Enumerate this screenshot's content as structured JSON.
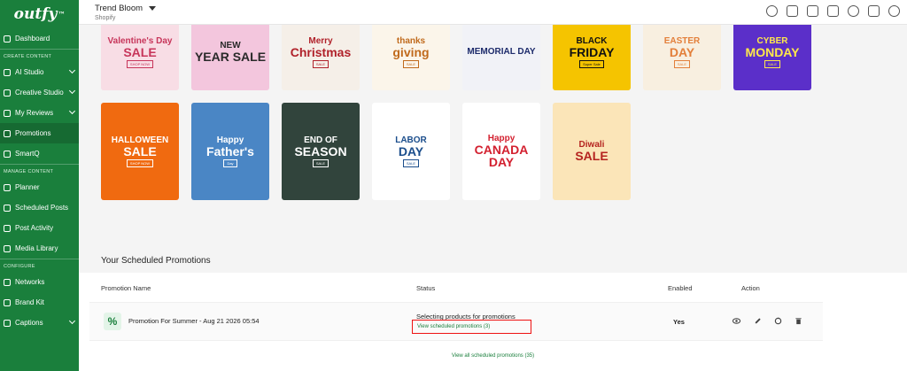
{
  "sidebar": {
    "logo": "outfy",
    "logo_mark": "™",
    "dashboard": "Dashboard",
    "sections": {
      "create": "CREATE CONTENT",
      "manage": "MANAGE CONTENT",
      "configure": "CONFIGURE"
    },
    "create_items": [
      "AI Studio",
      "Creative Studio",
      "My Reviews",
      "Promotions",
      "SmartQ"
    ],
    "manage_items": [
      "Planner",
      "Scheduled Posts",
      "Post Activity",
      "Media Library"
    ],
    "configure_items": [
      "Networks",
      "Brand Kit",
      "Captions"
    ]
  },
  "topbar": {
    "store_name": "Trend Bloom",
    "store_platform": "Shopify"
  },
  "templates": [
    {
      "line1": "Valentine's Day",
      "line2": "SALE",
      "line3": "SHOP NOW",
      "bg": "#f8dde5",
      "fg": "#c7355a"
    },
    {
      "line1": "NEW",
      "line2": "YEAR SALE",
      "line3": "",
      "bg": "#f3c6dd",
      "fg": "#2a2a2a"
    },
    {
      "line1": "Merry",
      "line2": "Christmas",
      "line3": "SALE",
      "bg": "#f5efe8",
      "fg": "#b0212a"
    },
    {
      "line1": "thanks",
      "line2": "giving",
      "line3": "SALE",
      "bg": "#fbf5ea",
      "fg": "#c06a1c"
    },
    {
      "line1": "MEMORIAL DAY",
      "line2": "",
      "line3": "",
      "bg": "#f1f2f7",
      "fg": "#1d2b6b"
    },
    {
      "line1": "BLACK",
      "line2": "FRIDAY",
      "line3": "Super Sale",
      "bg": "#f5c400",
      "fg": "#111111"
    },
    {
      "line1": "EASTER",
      "line2": "DAY",
      "line3": "SALE",
      "bg": "#f8efe0",
      "fg": "#e37f3a"
    },
    {
      "line1": "CYBER",
      "line2": "MONDAY",
      "line3": "SALE",
      "bg": "#5b2fc9",
      "fg": "#ffe94a"
    },
    {
      "line1": "HALLOWEEN",
      "line2": "SALE",
      "line3": "SHOP NOW",
      "bg": "#f06a10",
      "fg": "#ffffff"
    },
    {
      "line1": "Happy",
      "line2": "Father's",
      "line3": "Day",
      "bg": "#4a86c5",
      "fg": "#ffffff"
    },
    {
      "line1": "END OF",
      "line2": "SEASON",
      "line3": "SALE",
      "bg": "#31443c",
      "fg": "#ffffff"
    },
    {
      "line1": "LABOR",
      "line2": "DAY",
      "line3": "SALE",
      "bg": "#ffffff",
      "fg": "#1b4e8c"
    },
    {
      "line1": "Happy",
      "line2": "CANADA DAY",
      "line3": "",
      "bg": "#ffffff",
      "fg": "#d3202f"
    },
    {
      "line1": "Diwali",
      "line2": "SALE",
      "line3": "",
      "bg": "#fbe5b8",
      "fg": "#b5231f"
    }
  ],
  "scheduled": {
    "title": "Your Scheduled Promotions",
    "columns": {
      "name": "Promotion Name",
      "status": "Status",
      "enabled": "Enabled",
      "action": "Action"
    },
    "rows": [
      {
        "icon": "%",
        "name": "Promotion For Summer - Aug 21 2026 05:54",
        "status": "Selecting products for promotions",
        "link": "View scheduled promotions (3)",
        "enabled": "Yes"
      }
    ],
    "view_all": "View all scheduled promotions (35)"
  },
  "colors": {
    "brand": "#1a7f3c",
    "highlight": "#e11111"
  }
}
